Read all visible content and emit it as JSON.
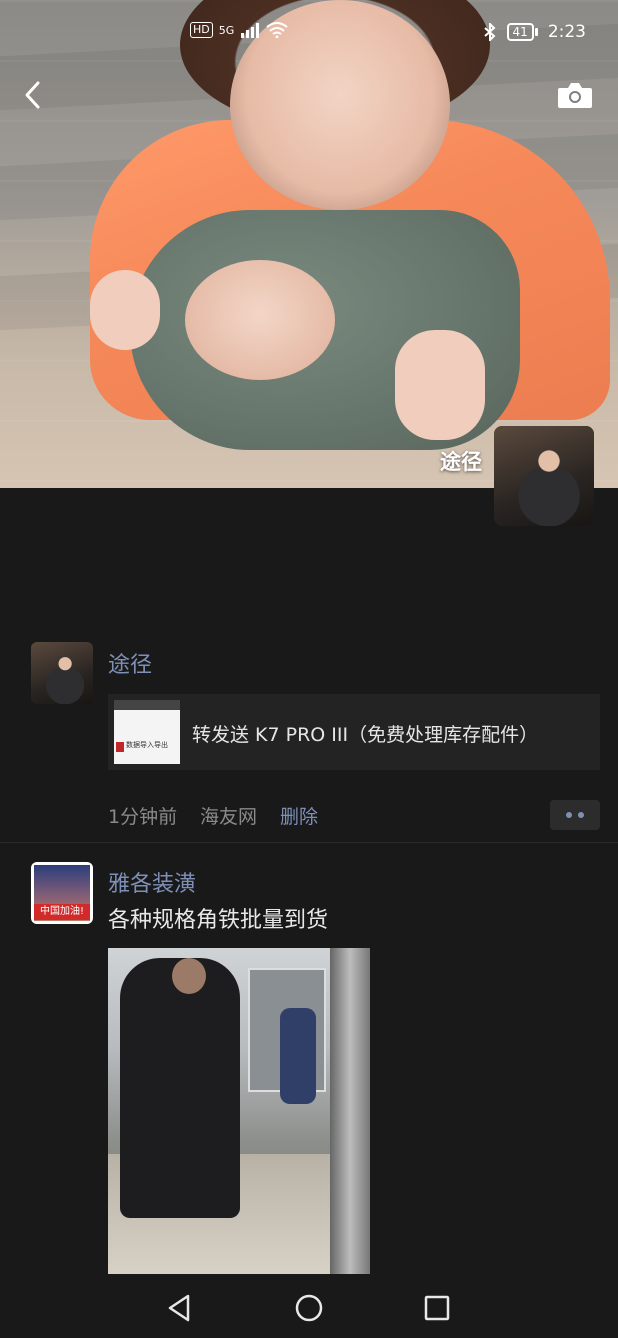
{
  "status_bar": {
    "hd": "HD",
    "network": "5G",
    "battery": "41",
    "time": "2:23"
  },
  "cover": {
    "owner_name": "途径"
  },
  "posts": [
    {
      "author": "途径",
      "share_title": "转发送 K7 PRO III（免费处理库存配件）",
      "thumb_text": "数据导入导出",
      "time_ago": "1分钟前",
      "source": "海友网",
      "delete_label": "删除"
    },
    {
      "author": "雅各装潢",
      "avatar_text": "中国加油!",
      "text": "各种规格角铁批量到货"
    }
  ],
  "icons": {
    "back": "chevron-left-icon",
    "camera": "camera-icon",
    "more": "more-dots-icon",
    "nav_back": "triangle-back-icon",
    "nav_home": "circle-home-icon",
    "nav_recent": "square-recent-icon"
  },
  "colors": {
    "link_blue": "#7e90b8",
    "background": "#191919"
  }
}
